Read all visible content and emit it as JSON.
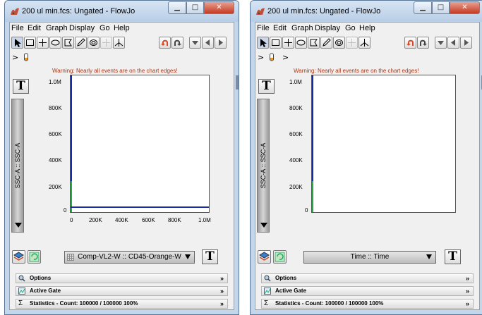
{
  "windows": [
    {
      "title": "200 ul min.fcs: Ungated - FlowJo",
      "menu": [
        "File",
        "Edit",
        "Graph",
        "Display",
        "Go",
        "Help"
      ],
      "breadcrumb_arrow": ">",
      "warning": "Warning: Nearly all events are on the chart edges!",
      "y_axis_label": "SSC-A :: SSC-A",
      "y_ticks": [
        "1.0M",
        "800K",
        "600K",
        "400K",
        "200K",
        "0"
      ],
      "x_ticks": [
        "0",
        "200K",
        "400K",
        "600K",
        "800K",
        "1.0M"
      ],
      "x_parameter": "Comp-VL2-W :: CD45-Orange-W",
      "text_button": "T",
      "panels": {
        "options": "Options",
        "active_gate": "Active Gate",
        "statistics": "Statistics  -  Count: 100000 / 100000       100%"
      }
    },
    {
      "title": "200 ul min.fcs: Ungated - FlowJo",
      "menu": [
        "File",
        "Edit",
        "Graph",
        "Display",
        "Go",
        "Help"
      ],
      "breadcrumb_arrow": ">",
      "breadcrumb_arrow2": ">",
      "warning": "Warning: Nearly all events are on the chart edges!",
      "y_axis_label": "SSC-A :: SSC-A",
      "y_ticks": [
        "1.0M",
        "800K",
        "600K",
        "400K",
        "200K",
        "0"
      ],
      "x_parameter": "Time :: Time",
      "text_button": "T",
      "panels": {
        "options": "Options",
        "active_gate": "Active Gate",
        "statistics": "Statistics  -  Count: 100000 / 100000       100%"
      }
    }
  ],
  "colors": {
    "warning": "#a63b1b",
    "title_bar": "#c4d6ea",
    "close_button": "#c53a22"
  }
}
